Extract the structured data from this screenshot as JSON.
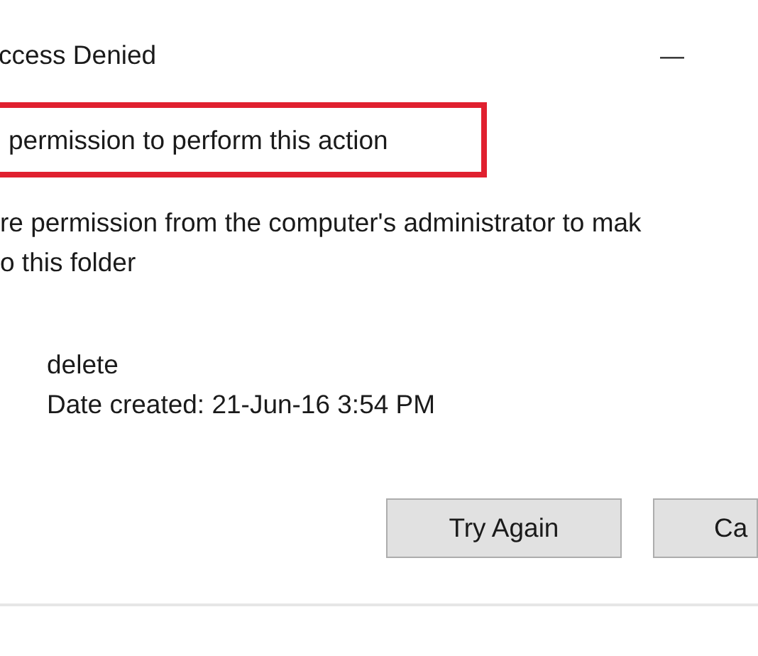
{
  "window": {
    "title": "ccess Denied",
    "controls": [
      "—"
    ]
  },
  "heading": {
    "text": "permission to perform this action",
    "highlighted": true
  },
  "message_lines": [
    "re permission from the computer's administrator to mak",
    "o this folder"
  ],
  "item": {
    "name": "delete",
    "date": "Date created: 21-Jun-16 3:54 PM"
  },
  "buttons": [
    "Try Again",
    "Ca"
  ]
}
